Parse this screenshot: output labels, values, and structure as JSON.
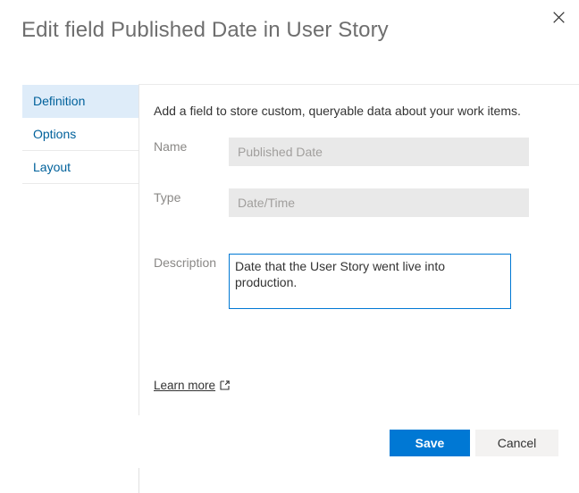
{
  "dialog": {
    "title": "Edit field Published Date in User Story",
    "close_icon": "close-icon"
  },
  "tabs": [
    {
      "label": "Definition",
      "selected": true
    },
    {
      "label": "Options",
      "selected": false
    },
    {
      "label": "Layout",
      "selected": false
    }
  ],
  "content": {
    "description": "Add a field to store custom, queryable data about your work items.",
    "fields": {
      "name": {
        "label": "Name",
        "value": "Published Date",
        "placeholder": "Published Date",
        "disabled": true
      },
      "type": {
        "label": "Type",
        "value": "Date/Time",
        "placeholder": "Date/Time",
        "disabled": true
      },
      "description": {
        "label": "Description",
        "value": "Date that the User Story went live into production.",
        "placeholder": ""
      }
    },
    "learn_more": {
      "label": "Learn more",
      "icon": "external-link-icon"
    }
  },
  "footer": {
    "save_label": "Save",
    "cancel_label": "Cancel"
  },
  "colors": {
    "accent": "#0078d4",
    "tab_selected_bg": "#deecf9",
    "tab_text": "#00619b",
    "title_text": "#6e6e6e",
    "label_text": "#8a8886",
    "disabled_input_bg": "#e9e9e9",
    "cancel_bg": "#f3f2f1"
  }
}
